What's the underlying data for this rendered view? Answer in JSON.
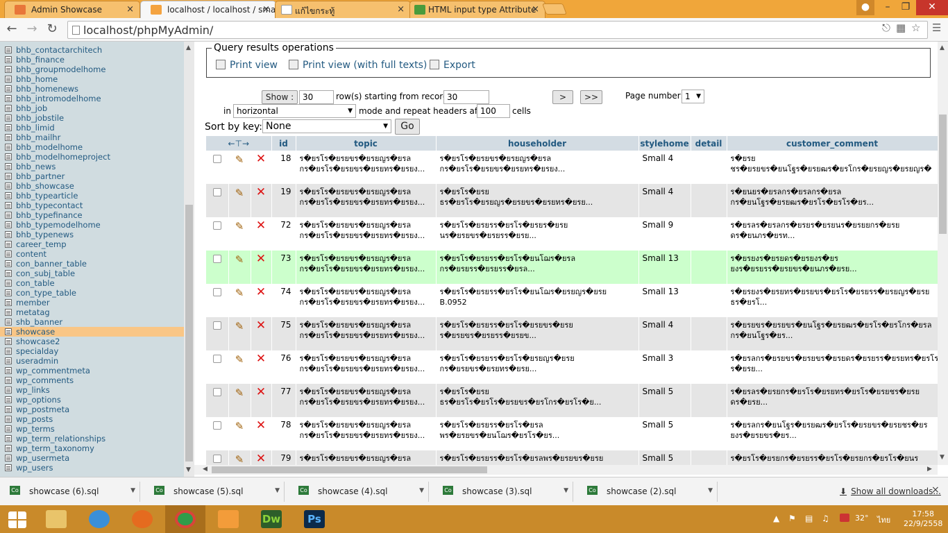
{
  "browser": {
    "tabs": [
      {
        "title": "Admin Showcase",
        "active": false
      },
      {
        "title": "localhost / localhost / sma",
        "active": true
      },
      {
        "title": "แก้ไขกระทู้",
        "active": false
      },
      {
        "title": "HTML input type Attribute",
        "active": false
      }
    ],
    "close_glyph": "×",
    "url": "localhost/phpMyAdmin/"
  },
  "sidebar": {
    "items": [
      "bhb_contactarchitech",
      "bhb_finance",
      "bhb_groupmodelhome",
      "bhb_home",
      "bhb_homenews",
      "bhb_intromodelhome",
      "bhb_job",
      "bhb_jobstile",
      "bhb_limid",
      "bhb_mailhr",
      "bhb_modelhome",
      "bhb_modelhomeproject",
      "bhb_news",
      "bhb_partner",
      "bhb_showcase",
      "bhb_typearticle",
      "bhb_typecontact",
      "bhb_typefinance",
      "bhb_typemodelhome",
      "bhb_typenews",
      "career_temp",
      "content",
      "con_banner_table",
      "con_subj_table",
      "con_table",
      "con_type_table",
      "member",
      "metatag",
      "shb_banner",
      "showcase",
      "showcase2",
      "specialday",
      "useradmin",
      "wp_commentmeta",
      "wp_comments",
      "wp_links",
      "wp_options",
      "wp_postmeta",
      "wp_posts",
      "wp_terms",
      "wp_term_relationships",
      "wp_term_taxonomy",
      "wp_usermeta",
      "wp_users"
    ],
    "selected": "showcase"
  },
  "query_ops": {
    "legend": "Query results operations",
    "print_view": "Print view",
    "print_view_full": "Print view (with full texts)",
    "export": "Export"
  },
  "nav": {
    "show_label": "Show :",
    "show_count": "30",
    "rows_label": "row(s) starting from record #",
    "start_record": "30",
    "next": ">",
    "last": ">>",
    "page_number_label": "Page number:",
    "page_number": "1",
    "in_label": "in",
    "mode": "horizontal",
    "mode_label": "mode and repeat headers after",
    "repeat_after": "100",
    "cells_label": "cells",
    "sort_label": "Sort by key:",
    "sort_value": "None",
    "go": "Go"
  },
  "table": {
    "columns": [
      "id",
      "topic",
      "householder",
      "stylehome",
      "detail",
      "customer_comment"
    ],
    "rows": [
      {
        "id": "18",
        "topic1": "ร�ยรโร�ยรยขร�ยรยญร�ยรล",
        "topic2": "กร�ยรโร�ยรยขร�ยรยทร�ยรยง...",
        "house1": "ร�ยรโร�ยรยขร�ยรยญร�ยรล",
        "house2": "กร�ยรโร�ยรยขร�ยรยทร�ยรยง...",
        "style": "Small 4",
        "cc1": "ร�ยรย",
        "cc2": "ชร�ยรยขร�ยนโฐร�ยรยฒร�ยรโกร�ยรยญร�ยรยญร�",
        "hl": false
      },
      {
        "id": "19",
        "topic1": "ร�ยรโร�ยรยขร�ยรยญร�ยรล",
        "topic2": "กร�ยรโร�ยรยขร�ยรยทร�ยรยง...",
        "house1": "ร�ยรโร�ยรย",
        "house2": "ธร�ยรโร�ยรยญร�ยรยขร�ยรยทร�ยรย...",
        "style": "Small 4",
        "cc1": "ร�ยนยร�ยรลกร�ยรลกร�ยรล",
        "cc2": "กร�ยนโฐร�ยรยฒร�ยรโร�ยรโร�ยร...",
        "hl": false
      },
      {
        "id": "72",
        "topic1": "ร�ยรโร�ยรยขร�ยรยญร�ยรล",
        "topic2": "กร�ยรโร�ยรยขร�ยรยทร�ยรยง...",
        "house1": "ร�ยรโร�ยรยรร�ยรโร�ยรยร�ยรย",
        "house2": "นร�ยรยขร�ยรยรร�ยรย...",
        "style": "Small 9",
        "cc1": "ร�ยรลร�ยรลกร�ยรยร�ยรยนร�ยรยยกร�ยรย",
        "cc2": "ดร�ยนภร�ยรท...",
        "hl": false
      },
      {
        "id": "73",
        "topic1": "ร�ยรโร�ยรยขร�ยรยญร�ยรล",
        "topic2": "กร�ยรโร�ยรยขร�ยรยทร�ยรยง...",
        "house1": "ร�ยรโร�ยรยรร�ยรโร�ยนโฌร�ยรล",
        "house2": "กร�ยรยรร�ยรยรร�ยรล...",
        "style": "Small 13",
        "cc1": "ร�ยรยงร�ยรยดร�ยรยงร�ยร",
        "cc2": "ยงร�ยรยรร�ยรยขร�ยนภร�ยรย...",
        "hl": true
      },
      {
        "id": "74",
        "topic1": "ร�ยรโร�ยรยขร�ยรยญร�ยรล",
        "topic2": "กร�ยรโร�ยรยขร�ยรยทร�ยรยง...",
        "house1": "ร�ยรโร�ยรยรร�ยรโร�ยนโฌร�ยรยญร�ยรย",
        "house2": "B.0952",
        "style": "Small 13",
        "cc1": "ร�ยรยงร�ยรยทร�ยรยขร�ยรโร�ยรยรร�ยรยญร�ยรย",
        "cc2": "ธร�ยรโ...",
        "hl": false
      },
      {
        "id": "75",
        "topic1": "ร�ยรโร�ยรยขร�ยรยญร�ยรล",
        "topic2": "กร�ยรโร�ยรยขร�ยรยทร�ยรยง...",
        "house1": "ร�ยรโร�ยรยรร�ยรโร�ยรยขร�ยรย",
        "house2": "ร�ยรยขร�ยรยรร�ยรยข...",
        "style": "Small 4",
        "cc1": "ร�ยรยขร�ยรยขร�ยนโฐร�ยรยฒร�ยรโร�ยรโกร�ยรล",
        "cc2": "กร�ยนโฐร�ยร...",
        "hl": false
      },
      {
        "id": "76",
        "topic1": "ร�ยรโร�ยรยขร�ยรยญร�ยรล",
        "topic2": "กร�ยรโร�ยรยขร�ยรยทร�ยรยง...",
        "house1": "ร�ยรโร�ยรยรร�ยรโร�ยรยญร�ยรย",
        "house2": "กร�ยรยขร�ยรยทร�ยรย...",
        "style": "Small 3",
        "cc1": "ร�ยรลกร�ยรยขร�ยรยขร�ยรยดร�ยรยรร�ยรยทร�ยรโร",
        "cc2": "ร�ยรย...",
        "hl": false
      },
      {
        "id": "77",
        "topic1": "ร�ยรโร�ยรยขร�ยรยญร�ยรล",
        "topic2": "กร�ยรโร�ยรยขร�ยรยทร�ยรยง...",
        "house1": "ร�ยรโร�ยรย",
        "house2": "ธร�ยรโร�ยรโร�ยรยขร�ยรโกร�ยรโร�ย...",
        "style": "Small 5",
        "cc1": "ร�ยรลร�ยรยกร�ยรโร�ยรยทร�ยรโร�ยรยชร�ยรย",
        "cc2": "ดร�ยรย...",
        "hl": false
      },
      {
        "id": "78",
        "topic1": "ร�ยรโร�ยรยขร�ยรยญร�ยรล",
        "topic2": "กร�ยรโร�ยรยขร�ยรยทร�ยรยง...",
        "house1": "ร�ยรโร�ยรยรร�ยรโร�ยรล",
        "house2": "พร�ยรยขร�ยนโฌร�ยรโร�ยร...",
        "style": "Small 5",
        "cc1": "ร�ยรลกร�ยนโฐร�ยรยฒร�ยรโร�ยรยขร�ยรยชร�ยร",
        "cc2": "ยงร�ยรยขร�ยร...",
        "hl": false
      },
      {
        "id": "79",
        "topic1": "ร�ยรโร�ยรยขร�ยรยญร�ยรล",
        "topic2": "",
        "house1": "ร�ยรโร�ยรยรร�ยรโร�ยรลพร�ยรยขร�ยรย",
        "house2": "",
        "style": "Small 5",
        "cc1": "ร�ยรโร�ยรยกร�ยรยรร�ยรโร�ยรยกร�ยรโร�ยนร",
        "cc2": "",
        "hl": false
      }
    ]
  },
  "downloads": {
    "items": [
      "showcase (6).sql",
      "showcase (5).sql",
      "showcase (4).sql",
      "showcase (3).sql",
      "showcase (2).sql"
    ],
    "show_all": "Show all downloads...",
    "close": "×"
  },
  "taskbar": {
    "temp": "32°",
    "lang": "ไทย",
    "time": "17:58",
    "date": "22/9/2558"
  },
  "colors": {
    "tabbar": "#f0a63a",
    "sidebar": "#d0dce0",
    "link": "#235a81",
    "selected_row": "#ccffcc",
    "taskbar": "#c98a2a"
  }
}
